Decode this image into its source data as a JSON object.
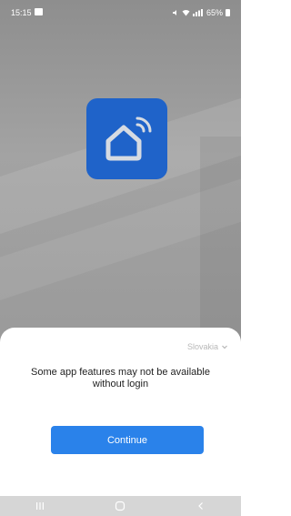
{
  "status_bar": {
    "time": "15:15",
    "battery": "65%"
  },
  "sheet": {
    "region": "Slovakia",
    "notice": "Some app features may not be available without login",
    "continue_label": "Continue"
  },
  "colors": {
    "logo_blue": "#1f63c9",
    "button_blue": "#2a82ea"
  },
  "icons": {
    "logo": "smart-home-icon",
    "recents": "recents-icon",
    "home": "home-nav-icon",
    "back": "back-icon"
  }
}
